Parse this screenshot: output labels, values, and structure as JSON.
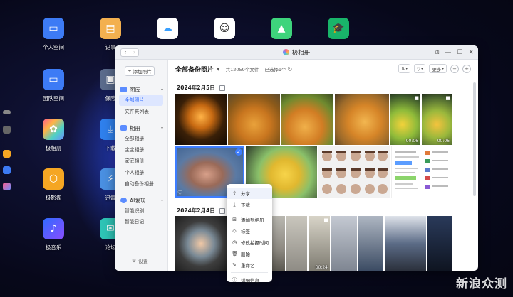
{
  "desktop": {
    "icons": [
      {
        "label": "个人空间",
        "color": "#3d7bf5"
      },
      {
        "label": "团队空间",
        "color": "#3d7bf5"
      },
      {
        "label": "极相册",
        "color": "#ff7a59"
      },
      {
        "label": "极影视",
        "color": "#f5a623"
      },
      {
        "label": "极音乐",
        "color": "#5b57e8"
      },
      {
        "label": "记事",
        "color": "#f3b04f"
      },
      {
        "label": "保险",
        "color": "#5a6b8c"
      },
      {
        "label": "下载",
        "color": "#2f80ed"
      },
      {
        "label": "迅雷",
        "color": "#4a90e2"
      },
      {
        "label": "论坛",
        "color": "#2ec4b6"
      }
    ],
    "top_icons": [
      {
        "name": "cloud-download-icon",
        "color": "#3aa0ff"
      },
      {
        "name": "user-avatar-icon",
        "color": "#f0f0f0"
      },
      {
        "name": "green-app-icon",
        "color": "#3ed47c"
      },
      {
        "name": "graduation-icon",
        "color": "#19b46a"
      }
    ]
  },
  "window": {
    "title": "极相册",
    "nav_back": "‹",
    "nav_forward": "›",
    "ctrl_restore": "⧉",
    "ctrl_min": "—",
    "ctrl_max": "☐",
    "ctrl_close": "✕"
  },
  "sidebar": {
    "add_photo": "添加照片",
    "sections": [
      {
        "title": "图库",
        "items": [
          "全部照片",
          "文件夹列表"
        ]
      },
      {
        "title": "相册",
        "items": [
          "全部相册",
          "宝宝相册",
          "家庭相册",
          "个人相册",
          "自动备份相册"
        ]
      },
      {
        "title": "AI发现",
        "items": [
          "智能识别",
          "智能日记"
        ]
      }
    ],
    "settings": "设置"
  },
  "toolbar": {
    "title": "全部备份照片",
    "count": "共12059个文件",
    "selected": "已选择1个",
    "sort": "⇅",
    "filter": "▽",
    "more": "更多",
    "zoom_out": "−",
    "zoom_in": "+"
  },
  "groups": [
    {
      "date": "2024年2月5日"
    },
    {
      "date": "2024年2月4日"
    }
  ],
  "durations": {
    "v1": "00:06",
    "v2": "00:06",
    "v3": "00:24"
  },
  "context_menu": {
    "items": [
      "分享",
      "下载",
      "添加到相册",
      "标签",
      "修改拍摄时间",
      "删除",
      "重命名",
      "详细信息"
    ],
    "icons": [
      "⇧",
      "⤓",
      "⊞",
      "◇",
      "◷",
      "🗑",
      "✎",
      "ⓘ"
    ]
  },
  "watermark": "新浪众测"
}
